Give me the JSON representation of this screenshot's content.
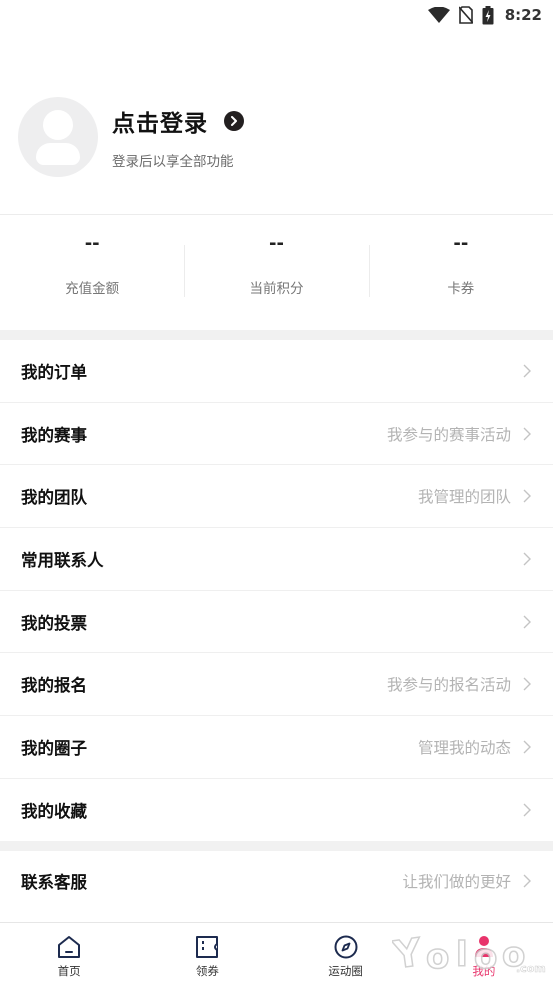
{
  "status_bar": {
    "time": "8:22",
    "icons": [
      "wifi-icon",
      "no-sim-icon",
      "battery-charging-icon"
    ]
  },
  "profile": {
    "title": "点击登录",
    "subtitle": "登录后以享全部功能"
  },
  "stats": [
    {
      "value": "--",
      "label": "充值金额"
    },
    {
      "value": "--",
      "label": "当前积分"
    },
    {
      "value": "--",
      "label": "卡券"
    }
  ],
  "menu": [
    {
      "label": "我的订单",
      "hint": ""
    },
    {
      "label": "我的赛事",
      "hint": "我参与的赛事活动"
    },
    {
      "label": "我的团队",
      "hint": "我管理的团队"
    },
    {
      "label": "常用联系人",
      "hint": ""
    },
    {
      "label": "我的投票",
      "hint": ""
    },
    {
      "label": "我的报名",
      "hint": "我参与的报名活动"
    },
    {
      "label": "我的圈子",
      "hint": "管理我的动态"
    },
    {
      "label": "我的收藏",
      "hint": ""
    }
  ],
  "menu2": [
    {
      "label": "联系客服",
      "hint": "让我们做的更好"
    }
  ],
  "tabs": [
    {
      "label": "首页",
      "icon": "home-icon"
    },
    {
      "label": "领券",
      "icon": "ticket-icon"
    },
    {
      "label": "运动圈",
      "icon": "compass-icon"
    },
    {
      "label": "我的",
      "icon": "profile-icon",
      "active": true
    }
  ],
  "colors": {
    "accent": "#e8336b",
    "separator": "#f1f1f1",
    "hint": "#b3b3b3"
  },
  "watermark": "Yoloo.com"
}
